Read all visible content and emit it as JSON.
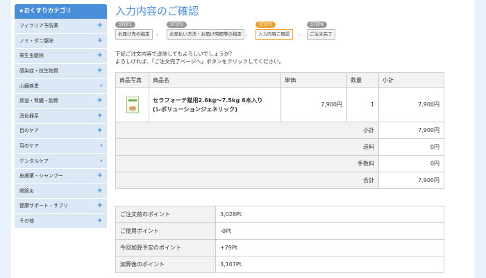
{
  "sidebar": {
    "header": "★おくすりカテゴリ",
    "items": [
      {
        "label": "フィラリア予防薬",
        "mark": "+"
      },
      {
        "label": "ノミ・ダニ駆除",
        "mark": "+"
      },
      {
        "label": "寄生虫駆除",
        "mark": "+"
      },
      {
        "label": "感染症・抗生物質",
        "mark": "+"
      },
      {
        "label": "心臓疾患",
        "mark": "›"
      },
      {
        "label": "尿道・腎臓・副腎",
        "mark": "+"
      },
      {
        "label": "消化器系",
        "mark": "+"
      },
      {
        "label": "目のケア",
        "mark": "+"
      },
      {
        "label": "耳のケア",
        "mark": "›"
      },
      {
        "label": "デンタルケア",
        "mark": "›"
      },
      {
        "label": "皮膚薬・シャンプー",
        "mark": "+"
      },
      {
        "label": "関節炎",
        "mark": "+"
      },
      {
        "label": "健康サポート・サプリ",
        "mark": "+"
      },
      {
        "label": "その他",
        "mark": "+"
      }
    ]
  },
  "page_title": "入力内容のご確認",
  "steps": [
    {
      "step": "STEP1",
      "label": "お届け先の指定"
    },
    {
      "step": "STEP2",
      "label": "お支払い方法・お届け時間等の指定"
    },
    {
      "step": "STEP3",
      "label": "入力内容ご確認"
    },
    {
      "step": "STEP4",
      "label": "ご注文完了"
    }
  ],
  "message": {
    "line1": "下記ご注文内容で送信してもよろしいでしょうか？",
    "line2": "よろしければ、「ご注文完了ページへ」ボタンをクリックしてください。"
  },
  "products": {
    "headers": [
      "商品写真",
      "商品名",
      "単価",
      "数量",
      "小計"
    ],
    "row": {
      "name_line1": "セラフォーテ猫用2.6kg～7.5kg 6本入り",
      "name_line2": "(レボリューションジェネリック)",
      "unit_price": "7,900円",
      "quantity": "1",
      "subtotal": "7,900円"
    },
    "summary": [
      {
        "label": "小計",
        "value": "7,900円"
      },
      {
        "label": "送料",
        "value": "0円"
      },
      {
        "label": "手数料",
        "value": "0円"
      },
      {
        "label": "合計",
        "value": "7,900円"
      }
    ]
  },
  "points": [
    {
      "label": "ご注文前のポイント",
      "value": "3,028Pt"
    },
    {
      "label": "ご使用ポイント",
      "value": "-0Pt"
    },
    {
      "label": "今回加算予定のポイント",
      "value": "+79Pt"
    },
    {
      "label": "加算後のポイント",
      "value": "3,107Pt"
    }
  ],
  "colors": {
    "accent": "#4a8dd8",
    "active_step": "#f0a030"
  }
}
